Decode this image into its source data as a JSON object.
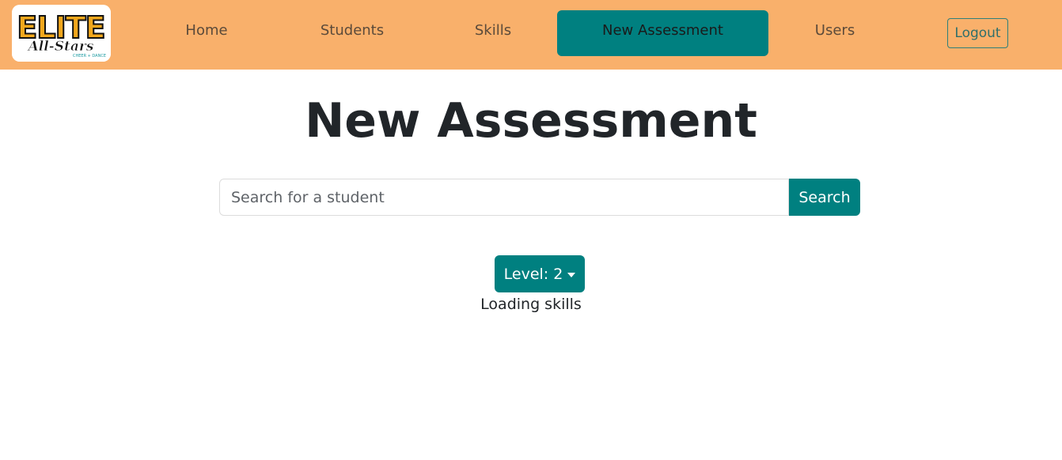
{
  "brand": {
    "logo_text": "ELITE",
    "logo_subtext": "All-Stars",
    "logo_tagline": "CHEER + DANCE"
  },
  "nav": {
    "items": [
      {
        "label": "Home",
        "active": false
      },
      {
        "label": "Students",
        "active": false
      },
      {
        "label": "Skills",
        "active": false
      },
      {
        "label": "New Assessment",
        "active": true
      },
      {
        "label": "Users",
        "active": false
      }
    ],
    "logout_label": "Logout"
  },
  "main": {
    "title": "New Assessment",
    "search": {
      "placeholder": "Search for a student",
      "value": "",
      "button_label": "Search"
    },
    "level": {
      "label": "Level: 2"
    },
    "status": "Loading skills"
  },
  "colors": {
    "navbar_bg": "#f9b06b",
    "accent": "#008080",
    "text": "#212529"
  }
}
